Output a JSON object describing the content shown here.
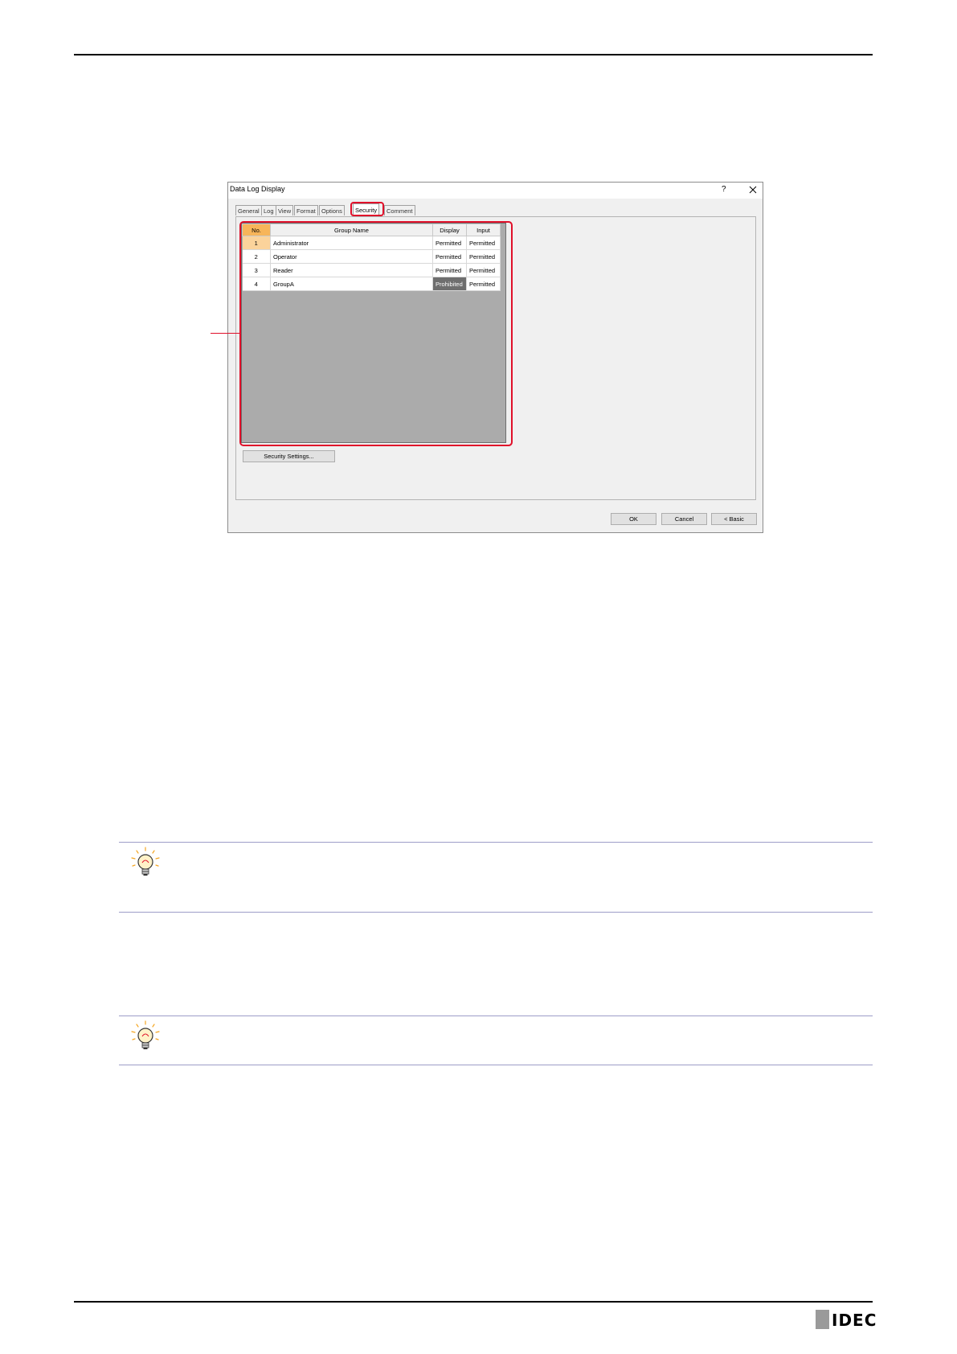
{
  "dialog": {
    "title": "Data Log Display",
    "help_label": "?",
    "tabs": [
      "General",
      "Log",
      "View",
      "Format",
      "Options",
      "Security",
      "Comment"
    ],
    "active_tab": "Security",
    "table": {
      "headers": [
        "No.",
        "Group Name",
        "Display",
        "Input"
      ],
      "rows": [
        {
          "no": "1",
          "group": "Administrator",
          "display": "Permitted",
          "input": "Permitted"
        },
        {
          "no": "2",
          "group": "Operator",
          "display": "Permitted",
          "input": "Permitted"
        },
        {
          "no": "3",
          "group": "Reader",
          "display": "Permitted",
          "input": "Permitted"
        },
        {
          "no": "4",
          "group": "GroupA",
          "display": "Prohibited",
          "input": "Permitted"
        }
      ]
    },
    "security_settings_button": "Security Settings...",
    "ok_button": "OK",
    "cancel_button": "Cancel",
    "basic_button": "< Basic"
  },
  "footer": {
    "logo_text": "IDEC"
  },
  "colors": {
    "highlight": "#e0102a",
    "hint_rule": "#9d9dc8",
    "bulb": "#f5a623"
  }
}
